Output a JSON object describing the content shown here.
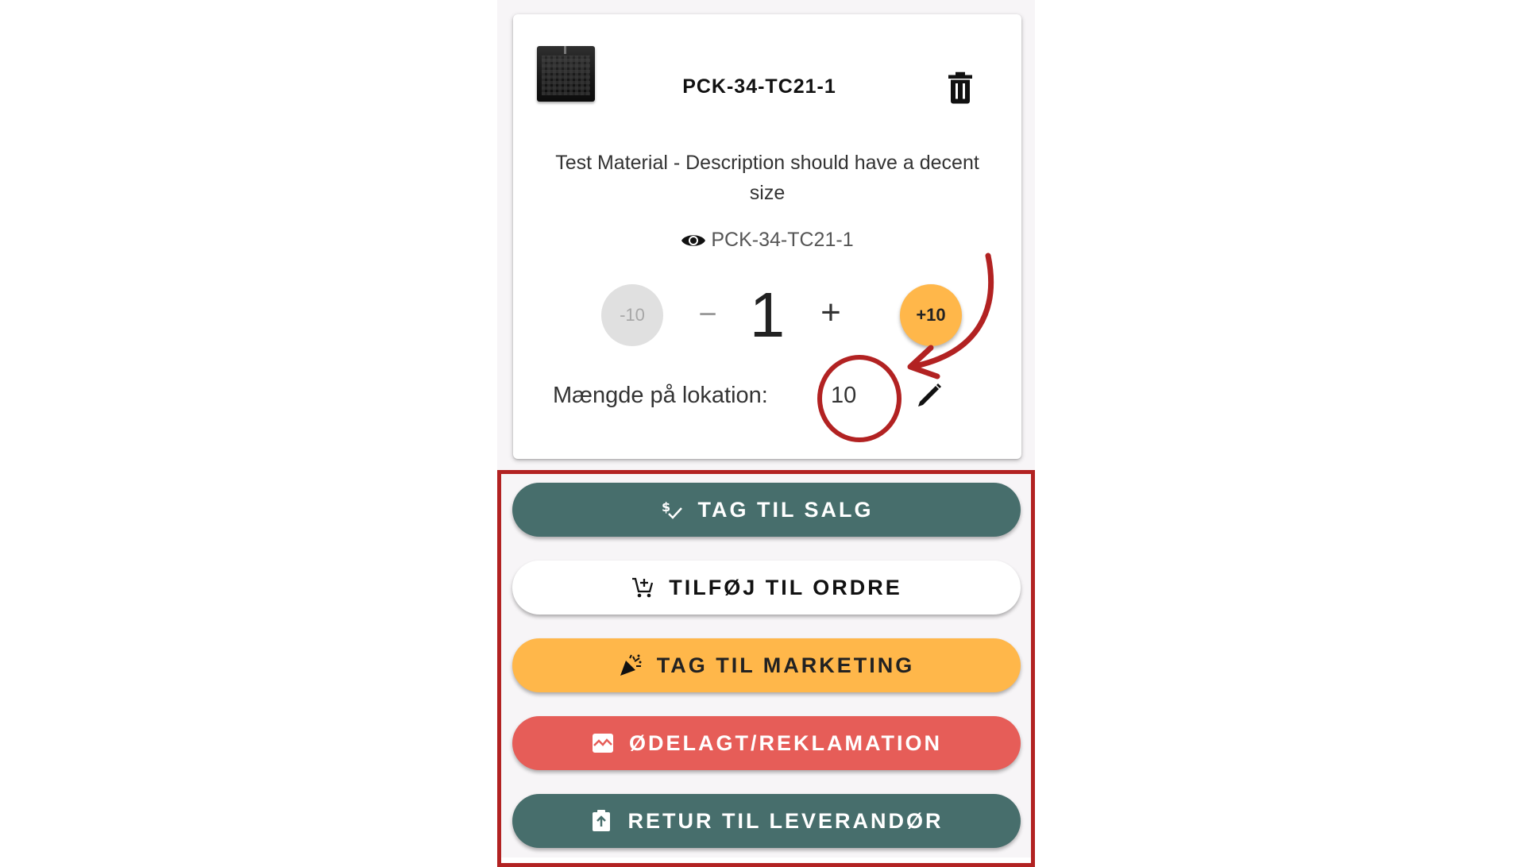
{
  "product": {
    "title": "PCK-34-TC21-1",
    "description": "Test Material - Description should have a decent size",
    "sku": "PCK-34-TC21-1"
  },
  "quantity": {
    "minus10_label": "-10",
    "minus_label": "−",
    "value": "1",
    "plus_label": "+",
    "plus10_label": "+10"
  },
  "location": {
    "label": "Mængde på lokation:",
    "value": "10"
  },
  "actions": {
    "salg": "TAG TIL SALG",
    "ordre": "TILFØJ TIL ORDRE",
    "marketing": "TAG TIL MARKETING",
    "odelagt": "ØDELAGT/REKLAMATION",
    "retur": "RETUR TIL LEVERANDØR"
  },
  "icons": {
    "trash": "trash-icon",
    "eye": "eye-icon",
    "edit": "pencil-icon",
    "salg": "currency-check-icon",
    "ordre": "cart-plus-icon",
    "marketing": "party-popper-icon",
    "odelagt": "broken-image-icon",
    "retur": "clipboard-arrow-icon"
  },
  "colors": {
    "teal": "#476e6c",
    "orange": "#ffb74a",
    "red": "#e65d58",
    "annotation_red": "#b22222"
  }
}
